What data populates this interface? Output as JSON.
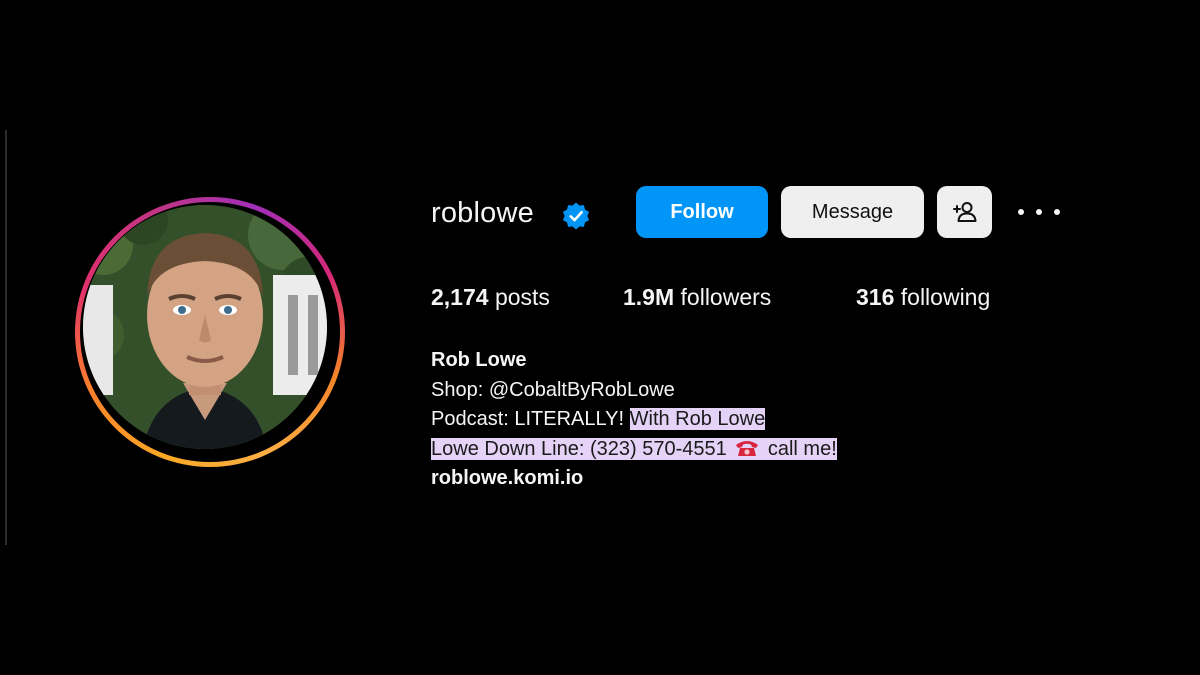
{
  "profile": {
    "username": "roblowe",
    "verified": true,
    "avatar_description": "profile photo",
    "buttons": {
      "follow": "Follow",
      "message": "Message"
    },
    "stats": {
      "posts_count": "2,174",
      "posts_label": "posts",
      "followers_count": "1.9M",
      "followers_label": "followers",
      "following_count": "316",
      "following_label": "following"
    },
    "bio": {
      "name": "Rob Lowe",
      "shop_line": "Shop: @CobaltByRobLowe",
      "podcast_prefix": "Podcast: LITERALLY! ",
      "podcast_highlighted": "With Rob Lowe",
      "phone_line_before": "Lowe Down Line: (323) 570-4551 ",
      "phone_line_after": " call me!",
      "link": "roblowe.komi.io"
    }
  },
  "colors": {
    "background": "#000000",
    "follow_button": "#0095f6",
    "secondary_button": "#efefef",
    "verified_badge": "#0095f6",
    "highlight": "#e5d3f7"
  },
  "icons": {
    "verified": "verified-badge-icon",
    "suggest": "add-person-icon",
    "more": "more-options-icon",
    "phone": "telephone-icon"
  }
}
